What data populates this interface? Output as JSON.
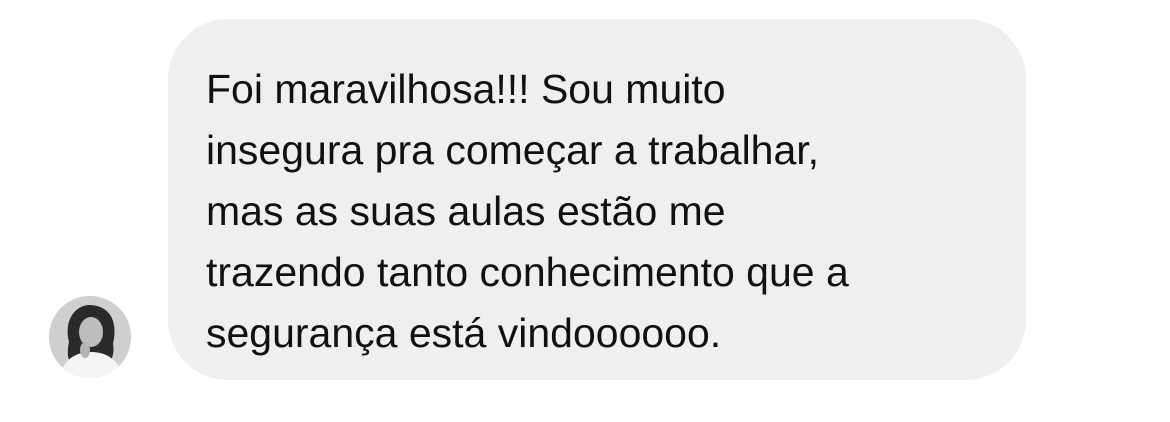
{
  "chat": {
    "message": {
      "text": "Foi maravilhosa!!! Sou muito\ninsegura pra começar a trabalhar,\nmas as suas aulas estão me\ntrazendo tanto conhecimento que a\nsegurança está vindoooooo."
    },
    "avatar": {
      "icon": "user-photo"
    }
  },
  "colors": {
    "background": "#ffffff",
    "bubble": "#efefef",
    "text": "#111111"
  }
}
